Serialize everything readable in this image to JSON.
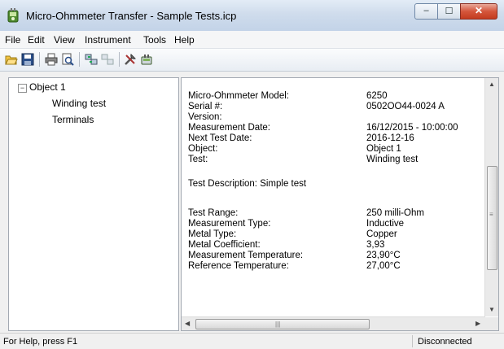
{
  "window": {
    "title": "Micro-Ohmmeter Transfer - Sample Tests.icp",
    "minimize_glyph": "–",
    "maximize_glyph": "☐",
    "close_glyph": "✕"
  },
  "menu": [
    "File",
    "Edit",
    "View",
    "Instrument",
    "Tools",
    "Help"
  ],
  "toolbar_icons": [
    "open-folder-icon",
    "save-icon",
    "print-icon",
    "print-preview-icon",
    "download-icon",
    "upload-icon",
    "tools-icon",
    "instrument-icon"
  ],
  "tree": {
    "expander": "−",
    "root": "Object 1",
    "children": [
      "Winding test",
      "Terminals"
    ]
  },
  "details": {
    "rows": [
      {
        "label": "Micro-Ohmmeter Model:",
        "value": "6250"
      },
      {
        "label": "Serial #:",
        "value": "0502OO44-0024 A"
      },
      {
        "label": "Version:",
        "value": ""
      },
      {
        "label": "Measurement Date:",
        "value": "16/12/2015 - 10:00:00"
      },
      {
        "label": "Next Test Date:",
        "value": "2016-12-16"
      },
      {
        "label": "Object:",
        "value": "Object 1"
      },
      {
        "label": "Test:",
        "value": "Winding test"
      }
    ],
    "description": "Test Description: Simple test",
    "range_rows": [
      {
        "label": "Test Range:",
        "value": "250 milli-Ohm"
      },
      {
        "label": "Measurement Type:",
        "value": "Inductive"
      },
      {
        "label": "Metal Type:",
        "value": "Copper"
      },
      {
        "label": "Metal Coefficient:",
        "value": "3,93"
      },
      {
        "label": "Measurement Temperature:",
        "value": "23,90°C"
      },
      {
        "label": "Reference Temperature:",
        "value": "27,00°C"
      }
    ]
  },
  "scrollbars": {
    "up": "▲",
    "down": "▼",
    "left": "◀",
    "right": "▶",
    "vertical_grip": "≡",
    "horizontal_grip": "|||"
  },
  "status": {
    "left": "For Help, press F1",
    "right": "Disconnected"
  },
  "colors": {
    "titlebar": "#cfdcec",
    "close_button": "#c43b1f",
    "panel_border": "#a3a9b2"
  }
}
